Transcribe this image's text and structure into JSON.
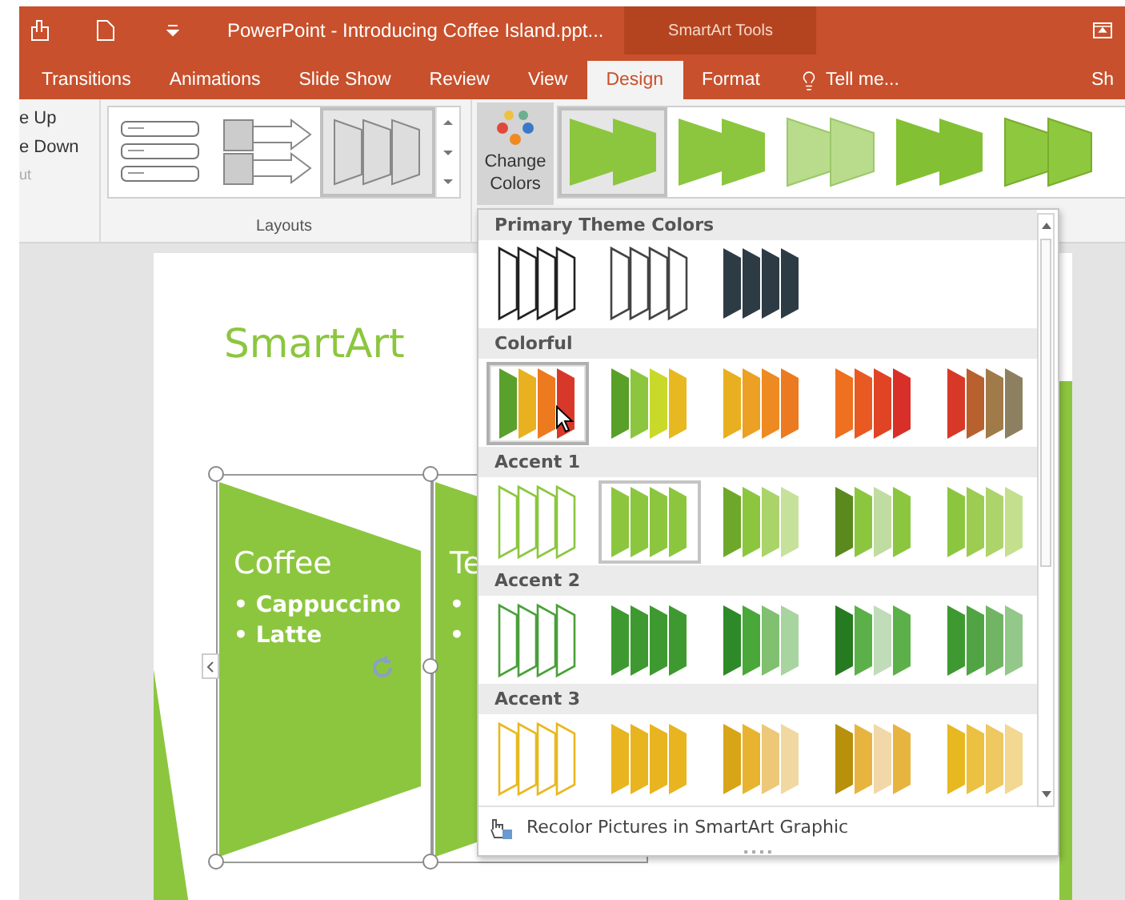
{
  "title_bar": {
    "title": "PowerPoint - Introducing Coffee Island.ppt...",
    "context_tab": "SmartArt Tools"
  },
  "tabs": [
    {
      "label": "Transitions",
      "kind": "tab",
      "selected": false
    },
    {
      "label": "Animations",
      "kind": "tab",
      "selected": false
    },
    {
      "label": "Slide Show",
      "kind": "tab",
      "selected": false
    },
    {
      "label": "Review",
      "kind": "tab",
      "selected": false
    },
    {
      "label": "View",
      "kind": "tab",
      "selected": false
    },
    {
      "label": "Design",
      "kind": "tab",
      "selected": true
    },
    {
      "label": "Format",
      "kind": "tab",
      "selected": false
    },
    {
      "label": "Tell me...",
      "kind": "search",
      "selected": false
    },
    {
      "label": "Sh",
      "kind": "tab",
      "selected": false
    }
  ],
  "ribbon": {
    "partial_group": {
      "items": [
        "e Up",
        "e Down"
      ],
      "label": "ut"
    },
    "layouts": {
      "label": "Layouts",
      "items": [
        {
          "kind": "list",
          "selected": false
        },
        {
          "kind": "process",
          "selected": false
        },
        {
          "kind": "funnel",
          "selected": true
        }
      ]
    },
    "change_colors": {
      "label": "Change Colors",
      "pressed": true
    },
    "styles": [
      {
        "kind": "flat",
        "selected": true
      },
      {
        "kind": "flat",
        "selected": false
      },
      {
        "kind": "light",
        "selected": false
      },
      {
        "kind": "shaded",
        "selected": false
      },
      {
        "kind": "bevel",
        "selected": false
      }
    ]
  },
  "slide": {
    "title": "SmartArt",
    "shapes": [
      {
        "heading": "Coffee",
        "bullets": [
          "• Cappuccino",
          "• Latte"
        ]
      },
      {
        "heading": "Te",
        "bullets": [
          "•",
          "•"
        ]
      }
    ]
  },
  "color_menu": {
    "sections": [
      {
        "title": "Primary Theme Colors",
        "variants": [
          {
            "kind": "outline",
            "selected": false,
            "hovered": false,
            "swatches": [
              {
                "color": "#222222"
              },
              {
                "color": "#222222"
              },
              {
                "color": "#222222"
              },
              {
                "color": "#222222"
              }
            ]
          },
          {
            "kind": "outline",
            "selected": false,
            "hovered": false,
            "swatches": [
              {
                "color": "#444444"
              },
              {
                "color": "#444444"
              },
              {
                "color": "#444444"
              },
              {
                "color": "#444444"
              }
            ]
          },
          {
            "kind": "fill",
            "selected": false,
            "hovered": false,
            "swatches": [
              {
                "color": "#2d3b45"
              },
              {
                "color": "#2d3b45"
              },
              {
                "color": "#2d3b45"
              },
              {
                "color": "#2d3b45"
              }
            ]
          }
        ]
      },
      {
        "title": "Colorful",
        "variants": [
          {
            "kind": "fill",
            "selected": false,
            "hovered": true,
            "swatches": [
              {
                "color": "#5aa02c"
              },
              {
                "color": "#e9b020"
              },
              {
                "color": "#ee7a20"
              },
              {
                "color": "#d8382a"
              }
            ]
          },
          {
            "kind": "fill",
            "selected": false,
            "hovered": false,
            "swatches": [
              {
                "color": "#58a028"
              },
              {
                "color": "#8cc63f"
              },
              {
                "color": "#c8d92a"
              },
              {
                "color": "#e8b820"
              }
            ]
          },
          {
            "kind": "fill",
            "selected": false,
            "hovered": false,
            "swatches": [
              {
                "color": "#e8b020"
              },
              {
                "color": "#eca024"
              },
              {
                "color": "#ee8a22"
              },
              {
                "color": "#ec7a20"
              }
            ]
          },
          {
            "kind": "fill",
            "selected": false,
            "hovered": false,
            "swatches": [
              {
                "color": "#ee7020"
              },
              {
                "color": "#e85a22"
              },
              {
                "color": "#e04424"
              },
              {
                "color": "#d83028"
              }
            ]
          },
          {
            "kind": "fill",
            "selected": false,
            "hovered": false,
            "swatches": [
              {
                "color": "#d83828"
              },
              {
                "color": "#b8602e"
              },
              {
                "color": "#a07a48"
              },
              {
                "color": "#8c8060"
              }
            ]
          }
        ]
      },
      {
        "title": "Accent 1",
        "variants": [
          {
            "kind": "outline",
            "selected": false,
            "hovered": false,
            "swatches": [
              {
                "color": "#8cc63f"
              },
              {
                "color": "#8cc63f"
              },
              {
                "color": "#8cc63f"
              },
              {
                "color": "#8cc63f"
              }
            ]
          },
          {
            "kind": "fill",
            "selected": true,
            "hovered": false,
            "swatches": [
              {
                "color": "#8cc63f"
              },
              {
                "color": "#8cc63f"
              },
              {
                "color": "#8cc63f"
              },
              {
                "color": "#8cc63f"
              }
            ]
          },
          {
            "kind": "fill",
            "selected": false,
            "hovered": false,
            "swatches": [
              {
                "color": "#6ea82a"
              },
              {
                "color": "#8cc63f"
              },
              {
                "color": "#aad46a"
              },
              {
                "color": "#c6e29a"
              }
            ]
          },
          {
            "kind": "fill",
            "selected": false,
            "hovered": false,
            "swatches": [
              {
                "color": "#5a8a1e"
              },
              {
                "color": "#8cc63f"
              },
              {
                "color": "#c0dca0"
              },
              {
                "color": "#8cc63f"
              }
            ]
          },
          {
            "kind": "fill",
            "selected": false,
            "hovered": false,
            "swatches": [
              {
                "color": "#8cc63f"
              },
              {
                "color": "#9ccc52"
              },
              {
                "color": "#acd46a"
              },
              {
                "color": "#c4e08e"
              }
            ]
          }
        ]
      },
      {
        "title": "Accent 2",
        "variants": [
          {
            "kind": "outline",
            "selected": false,
            "hovered": false,
            "swatches": [
              {
                "color": "#4aa03a"
              },
              {
                "color": "#4aa03a"
              },
              {
                "color": "#4aa03a"
              },
              {
                "color": "#4aa03a"
              }
            ]
          },
          {
            "kind": "fill",
            "selected": false,
            "hovered": false,
            "swatches": [
              {
                "color": "#3e9a30"
              },
              {
                "color": "#3e9a30"
              },
              {
                "color": "#3e9a30"
              },
              {
                "color": "#3e9a30"
              }
            ]
          },
          {
            "kind": "fill",
            "selected": false,
            "hovered": false,
            "swatches": [
              {
                "color": "#2e8a28"
              },
              {
                "color": "#4aa83a"
              },
              {
                "color": "#80c070"
              },
              {
                "color": "#a8d4a0"
              }
            ]
          },
          {
            "kind": "fill",
            "selected": false,
            "hovered": false,
            "swatches": [
              {
                "color": "#267a20"
              },
              {
                "color": "#5cb04a"
              },
              {
                "color": "#c0dcb8"
              },
              {
                "color": "#5cb04a"
              }
            ]
          },
          {
            "kind": "fill",
            "selected": false,
            "hovered": false,
            "swatches": [
              {
                "color": "#3e9a30"
              },
              {
                "color": "#50a444"
              },
              {
                "color": "#70b464"
              },
              {
                "color": "#94c88a"
              }
            ]
          }
        ]
      },
      {
        "title": "Accent 3",
        "variants": [
          {
            "kind": "outline",
            "selected": false,
            "hovered": false,
            "swatches": [
              {
                "color": "#e8b820"
              },
              {
                "color": "#e8b820"
              },
              {
                "color": "#e8b820"
              },
              {
                "color": "#e8b820"
              }
            ]
          },
          {
            "kind": "fill",
            "selected": false,
            "hovered": false,
            "swatches": [
              {
                "color": "#e8b420"
              },
              {
                "color": "#e8b420"
              },
              {
                "color": "#e8b420"
              },
              {
                "color": "#e8b420"
              }
            ]
          },
          {
            "kind": "fill",
            "selected": false,
            "hovered": false,
            "swatches": [
              {
                "color": "#d8a418"
              },
              {
                "color": "#e8b430"
              },
              {
                "color": "#ecc878"
              },
              {
                "color": "#f0d8a0"
              }
            ]
          },
          {
            "kind": "fill",
            "selected": false,
            "hovered": false,
            "swatches": [
              {
                "color": "#b8900c"
              },
              {
                "color": "#e8b440"
              },
              {
                "color": "#f2d8a8"
              },
              {
                "color": "#e8b440"
              }
            ]
          },
          {
            "kind": "fill",
            "selected": false,
            "hovered": false,
            "swatches": [
              {
                "color": "#e8b820"
              },
              {
                "color": "#ecc040"
              },
              {
                "color": "#eec860"
              },
              {
                "color": "#f2d890"
              }
            ]
          }
        ]
      }
    ],
    "footer": "Recolor Pictures in SmartArt Graphic"
  }
}
